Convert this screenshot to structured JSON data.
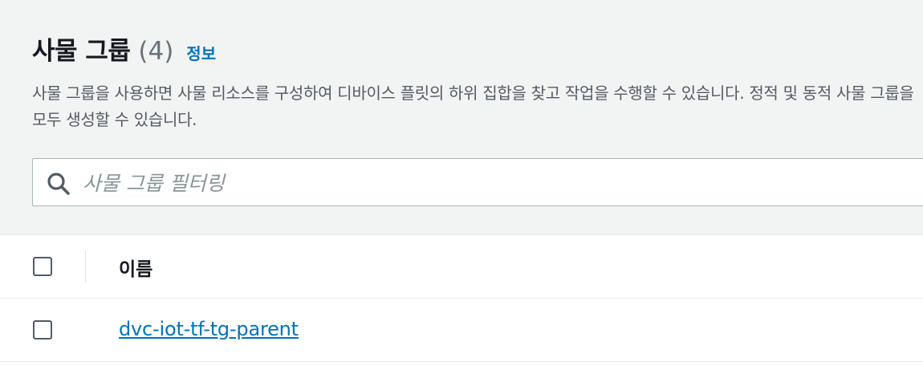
{
  "header": {
    "title": "사물 그룹",
    "count": "(4)",
    "info_link": "정보",
    "description": "사물 그룹을 사용하면 사물 리소스를 구성하여 디바이스 플릿의 하위 집합을 찾고 작업을 수행할 수 있습니다. 정적 및 동적 사물 그룹을 모두 생성할 수 있습니다."
  },
  "filter": {
    "icon": "search-icon",
    "value": "",
    "placeholder": "사물 그룹 필터링"
  },
  "table": {
    "columns": [
      "이름"
    ],
    "rows": [
      {
        "name": "dvc-iot-tf-tg-parent",
        "selected": false
      }
    ]
  },
  "colors": {
    "link": "#0073bb",
    "panel_bg": "#f2f3f3",
    "text": "#16191f",
    "muted": "#687078"
  }
}
